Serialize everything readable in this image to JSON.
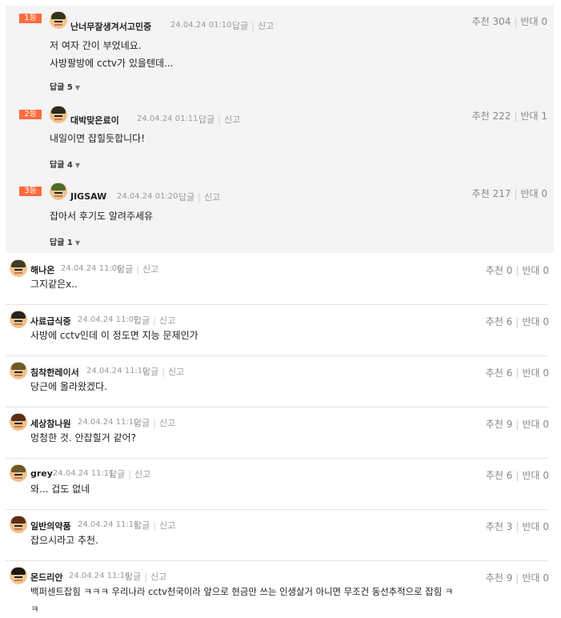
{
  "best_comments": [
    {
      "rank": "1등",
      "nick": "난너무잘생겨서고민중",
      "date": "24.04.24 01:10",
      "reply": "답글",
      "report": "신고",
      "up_label": "추천",
      "up": "304",
      "down_label": "반대",
      "down": "0",
      "lines": [
        "저 여자 간이 부었네요.",
        "사방팔방에 cctv가 있을텐데..."
      ],
      "reply_count": "답글 5"
    },
    {
      "rank": "2등",
      "nick": "대박맞은료이",
      "date": "24.04.24 01:11",
      "reply": "답글",
      "report": "신고",
      "up_label": "추천",
      "up": "222",
      "down_label": "반대",
      "down": "1",
      "lines": [
        "내일이면 잡힐듯합니다!"
      ],
      "reply_count": "답글 4"
    },
    {
      "rank": "3등",
      "nick": "JIGSAW",
      "date": "24.04.24 01:20",
      "reply": "답글",
      "report": "신고",
      "up_label": "추천",
      "up": "217",
      "down_label": "반대",
      "down": "0",
      "lines": [
        "잡아서 후기도 알려주세유"
      ],
      "reply_count": "답글 1"
    }
  ],
  "comments": [
    {
      "nick": "해나온",
      "date": "24.04.24 11:06",
      "reply": "답글",
      "report": "신고",
      "up_label": "추천",
      "up": "0",
      "down_label": "반대",
      "down": "0",
      "lines": [
        "그지같은x.."
      ]
    },
    {
      "nick": "사료급식중",
      "date": "24.04.24 11:07",
      "reply": "답글",
      "report": "신고",
      "up_label": "추천",
      "up": "6",
      "down_label": "반대",
      "down": "0",
      "lines": [
        "사방에 cctv인데 이 정도면 지능 문제인가"
      ]
    },
    {
      "nick": "침착한레이서",
      "date": "24.04.24 11:10",
      "reply": "답글",
      "report": "신고",
      "up_label": "추천",
      "up": "6",
      "down_label": "반대",
      "down": "0",
      "lines": [
        "당근에 올라왔겠다."
      ]
    },
    {
      "nick": "세상참나원",
      "date": "24.04.24 11:10",
      "reply": "답글",
      "report": "신고",
      "up_label": "추천",
      "up": "9",
      "down_label": "반대",
      "down": "0",
      "lines": [
        "멍청한 것. 안잡힐거 같어?"
      ]
    },
    {
      "nick": "grey",
      "date": "24.04.24 11:11",
      "reply": "답글",
      "report": "신고",
      "up_label": "추천",
      "up": "6",
      "down_label": "반대",
      "down": "0",
      "lines": [
        "와... 겁도 없네"
      ]
    },
    {
      "nick": "일반의약품",
      "date": "24.04.24 11:13",
      "reply": "답글",
      "report": "신고",
      "up_label": "추천",
      "up": "3",
      "down_label": "반대",
      "down": "0",
      "lines": [
        "잡으시라고 추천."
      ]
    },
    {
      "nick": "몬드리안",
      "date": "24.04.24 11:14",
      "reply": "답글",
      "report": "신고",
      "up_label": "추천",
      "up": "9",
      "down_label": "반대",
      "down": "0",
      "lines": [
        "백퍼센트잡힘 ㅋㅋㅋ 우리나라 cctv천국이라 앞으로 현금만 쓰는 인생살거 아니면 무조건 동선추적으로 잡힘 ㅋ",
        "ㅋ"
      ]
    }
  ]
}
